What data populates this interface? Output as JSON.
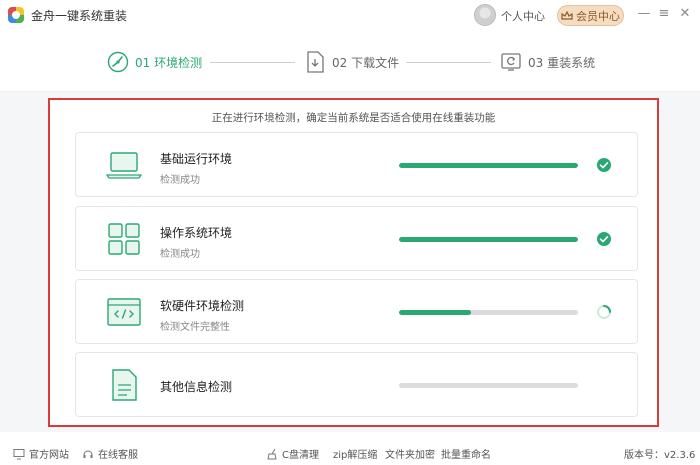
{
  "app": {
    "title": "金舟一键系统重装",
    "user_center": "个人中心",
    "vip_center": "会员中心",
    "minimize": "—",
    "menu": "≡",
    "close": "✕"
  },
  "steps": [
    {
      "label": "01 环境检测",
      "state": "active"
    },
    {
      "label": "02 下载文件",
      "state": "inactive"
    },
    {
      "label": "03 重装系统",
      "state": "inactive"
    }
  ],
  "notice": "正在进行环境检测，确定当前系统是否适合使用在线重装功能",
  "checks": [
    {
      "name": "基础运行环境",
      "status_text": "检测成功",
      "progress": 1.0,
      "state": "done",
      "icon": "laptop-icon"
    },
    {
      "name": "操作系统环境",
      "status_text": "检测成功",
      "progress": 1.0,
      "state": "done",
      "icon": "grid-icon"
    },
    {
      "name": "软硬件环境检测",
      "status_text": "检测文件完整性",
      "progress": 0.4,
      "state": "loading",
      "icon": "code-window-icon"
    },
    {
      "name": "其他信息检测",
      "status_text": "",
      "progress": 0.0,
      "state": "pending",
      "icon": "document-icon"
    }
  ],
  "footer": {
    "website": "官方网站",
    "support": "在线客服",
    "c_clean": "C盘清理",
    "zip": "zip解压缩",
    "encrypt": "文件夹加密",
    "rename": "批量重命名",
    "version": "版本号：v2.3.6"
  },
  "colors": {
    "accent": "#2aa874",
    "highlight_border": "#d93a3a",
    "vip_bg": "#f6dcc1"
  }
}
